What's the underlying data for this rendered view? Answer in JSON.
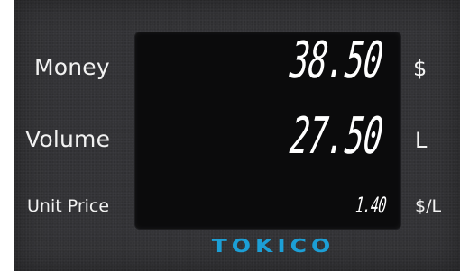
{
  "rows": [
    {
      "label": "Money",
      "value": "38.50",
      "unit": "$"
    },
    {
      "label": "Volume",
      "value": "27.50",
      "unit": "L"
    },
    {
      "label": "Unit Price",
      "value": "1.40",
      "unit": "$/L"
    }
  ],
  "brand": "TOKICO",
  "colors": {
    "panel": "#333336",
    "display": "#0b0b0c",
    "digits": "#ffffff",
    "brand": "#1c9fd6"
  }
}
